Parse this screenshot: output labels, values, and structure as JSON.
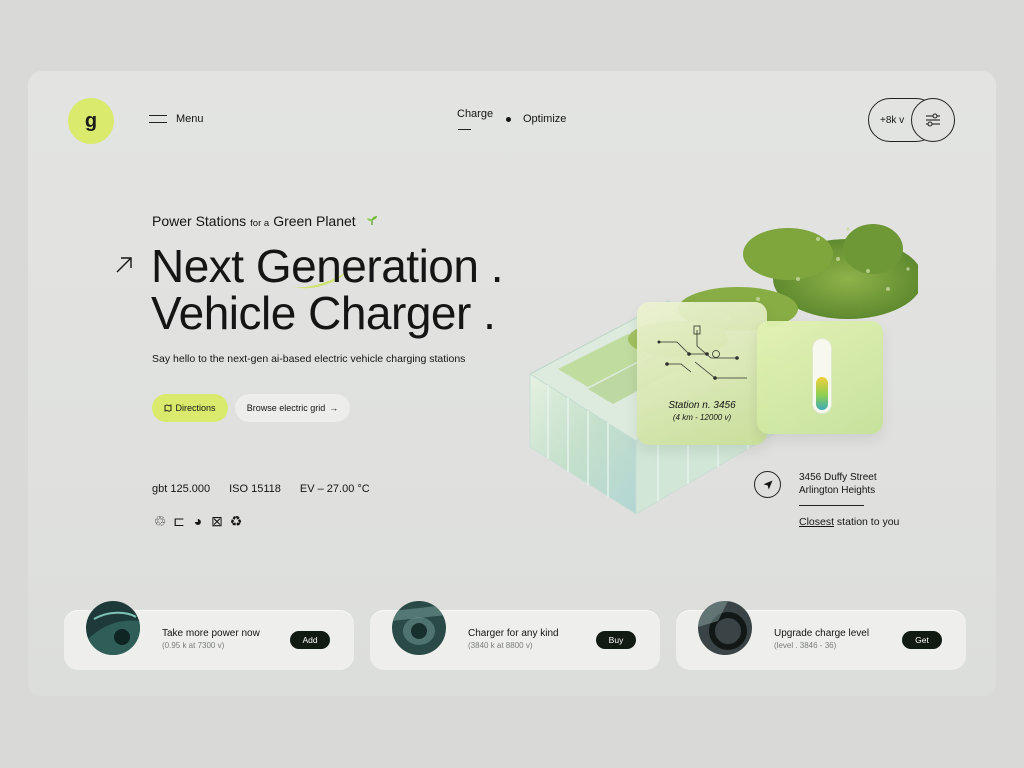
{
  "header": {
    "logo_letter": "g",
    "menu_label": "Menu",
    "nav": [
      {
        "label": "Charge",
        "active": true
      },
      {
        "label": "Optimize",
        "active": false
      }
    ],
    "pill_label": "+8k v",
    "filter_icon": "sliders-icon"
  },
  "hero": {
    "subtitle_a": "Power Stations",
    "subtitle_small": "for a",
    "subtitle_b": "Green Planet",
    "headline_line1": "Next Generation .",
    "headline_line2": "Vehicle Charger .",
    "tagline": "Say hello to the next-gen ai-based electric vehicle charging stations",
    "directions_label": "Directions",
    "browse_label": "Browse electric grid",
    "specs": [
      "gbt 125.000",
      "ISO 15118",
      "EV – 27.00 °C"
    ],
    "cert_icons": [
      "♲",
      "⊏",
      "◕",
      "⊠",
      "♻"
    ]
  },
  "station_card": {
    "name": "Station n. 3456",
    "detail": "(4 km - 12000 v)"
  },
  "gauge_card": {
    "level": 0.45
  },
  "location": {
    "address_line1": "3456 Duffy Street",
    "address_line2": "Arlington Heights",
    "closest_word": "Closest",
    "closest_rest": " station to you"
  },
  "products": [
    {
      "title": "Take more power now",
      "sub": "(0.95 k at 7300 v)",
      "button": "Add"
    },
    {
      "title": "Charger for any kind",
      "sub": "(3840 k at 8800 v)",
      "button": "Buy"
    },
    {
      "title": "Upgrade charge level",
      "sub": "(level . 3846 - 36)",
      "button": "Get"
    }
  ],
  "colors": {
    "accent": "#d9ea6c",
    "dark": "#121a14",
    "background": "#e2e3e1"
  }
}
